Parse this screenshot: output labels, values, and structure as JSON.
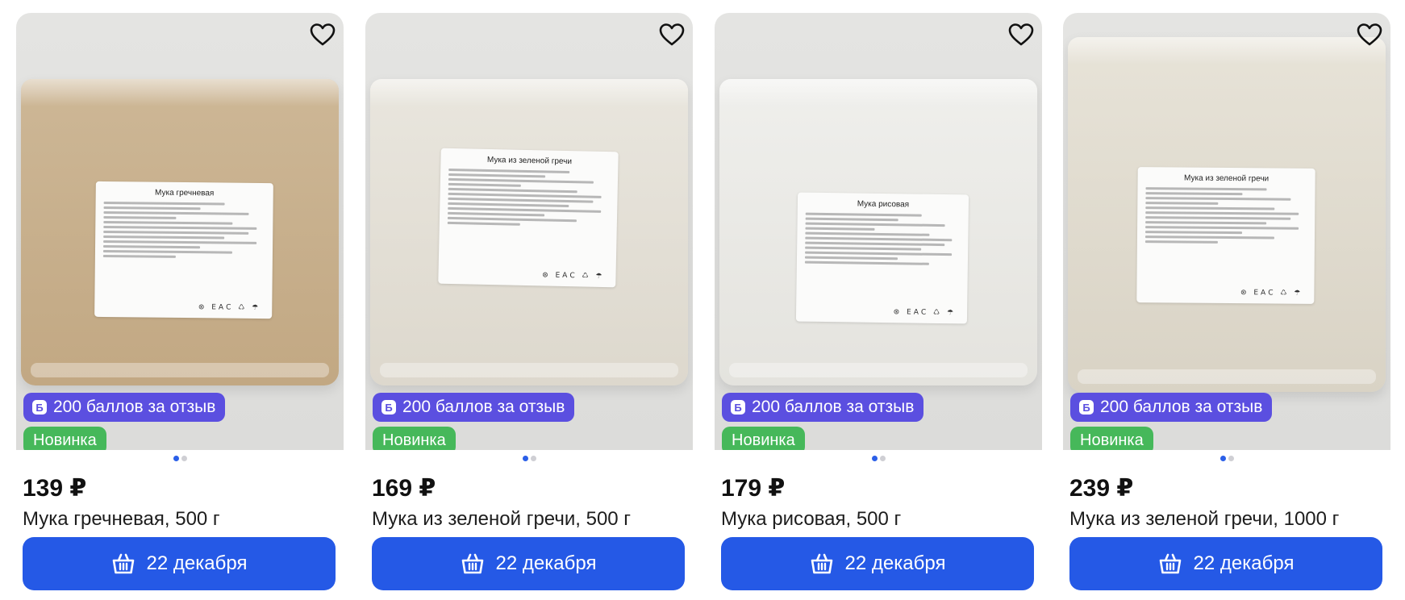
{
  "products": [
    {
      "price": "139 ₽",
      "title": "Мука гречневая, 500 г",
      "label_title": "Мука гречневая",
      "bag_color_top": "#cdb796",
      "bag_color_bottom": "#c2a883",
      "points_badge": "200 баллов за отзыв",
      "new_badge": "Новинка",
      "delivery": "22 декабря"
    },
    {
      "price": "169 ₽",
      "title": "Мука из зеленой гречи, 500 г",
      "label_title": "Мука из зеленой гречи",
      "bag_color_top": "#e9e6de",
      "bag_color_bottom": "#ddd8cd",
      "points_badge": "200 баллов за отзыв",
      "new_badge": "Новинка",
      "delivery": "22 декабря"
    },
    {
      "price": "179 ₽",
      "title": "Мука рисовая, 500 г",
      "label_title": "Мука рисовая",
      "bag_color_top": "#efefec",
      "bag_color_bottom": "#e4e3de",
      "points_badge": "200 баллов за отзыв",
      "new_badge": "Новинка",
      "delivery": "22 декабря"
    },
    {
      "price": "239 ₽",
      "title": "Мука из зеленой гречи, 1000 г",
      "label_title": "Мука из зеленой гречи",
      "bag_color_top": "#e7e3d8",
      "bag_color_bottom": "#d9d3c5",
      "points_badge": "200 баллов за отзыв",
      "new_badge": "Новинка",
      "delivery": "22 декабря"
    }
  ],
  "icons": {
    "favorite": "heart-icon",
    "points": "points-b-icon",
    "cart": "basket-icon"
  },
  "points_icon_letter": "Б",
  "label_marks": "⊛ ЕАС ♺ ☂",
  "colors": {
    "points_badge": "#5b4fe0",
    "new_badge": "#46b85a",
    "cart_button": "#2559e6",
    "dot_active": "#2b5fe8",
    "dot_inactive": "#cfcfd4"
  },
  "carousel": {
    "total_slides": 2,
    "active_slide": 1
  }
}
